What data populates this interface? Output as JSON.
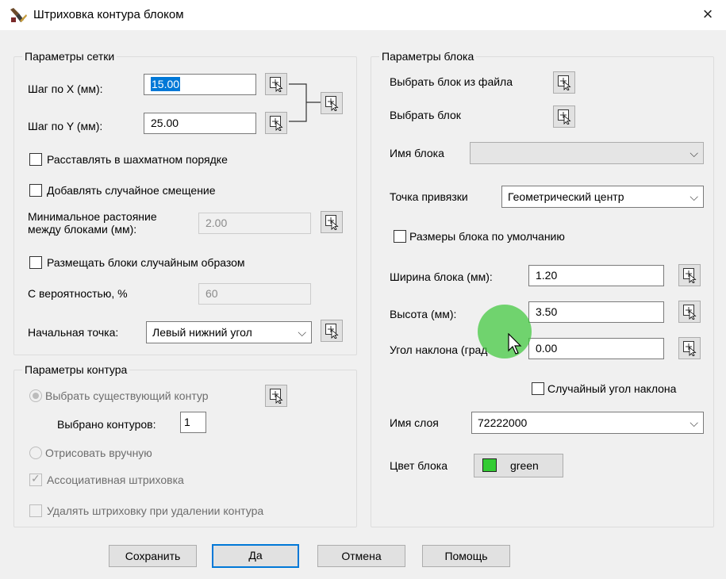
{
  "window": {
    "title": "Штриховка контура блоком",
    "close_glyph": "×",
    "icon": "hatch-brush-icon"
  },
  "grid": {
    "title": "Параметры сетки",
    "step_x_label": "Шаг по X (мм):",
    "step_x_value": "15.00",
    "step_y_label": "Шаг по Y (мм):",
    "step_y_value": "25.00",
    "checker_label": "Расставлять в шахматном порядке",
    "random_offset_label": "Добавлять случайное смещение",
    "min_distance_label": "Минимальное растояние между блоками (мм):",
    "min_distance_value": "2.00",
    "random_place_label": "Размещать блоки случайным образом",
    "probability_label": "С вероятностью, %",
    "probability_value": "60",
    "start_point_label": "Начальная точка:",
    "start_point_value": "Левый нижний угол"
  },
  "contour": {
    "title": "Параметры контура",
    "select_existing_label": "Выбрать существующий контур",
    "selected_count_label": "Выбрано контуров:",
    "selected_count_value": "1",
    "draw_manual_label": "Отрисовать вручную",
    "associative_label": "Ассоциативная штриховка",
    "delete_hatch_label": "Удалять штриховку при удалении контура"
  },
  "block": {
    "title": "Параметры блока",
    "select_from_file_label": "Выбрать блок из файла",
    "select_block_label": "Выбрать блок",
    "block_name_label": "Имя блока",
    "block_name_value": "",
    "anchor_label": "Точка привязки",
    "anchor_value": "Геометрический центр",
    "default_size_label": "Размеры блока по умолчанию",
    "width_label": "Ширина блока (мм):",
    "width_value": "1.20",
    "height_label": "Высота (мм):",
    "height_value": "3.50",
    "angle_label": "Угол наклона (град",
    "angle_value": "0.00",
    "random_angle_label": "Случайный угол наклона",
    "layer_label": "Имя слоя",
    "layer_value": "72222000",
    "color_label": "Цвет блока",
    "color_value": "green",
    "color_hex": "#33cc33"
  },
  "buttons": {
    "save": "Сохранить",
    "ok": "Да",
    "cancel": "Отмена",
    "help": "Помощь"
  },
  "accent": "#0078d7"
}
